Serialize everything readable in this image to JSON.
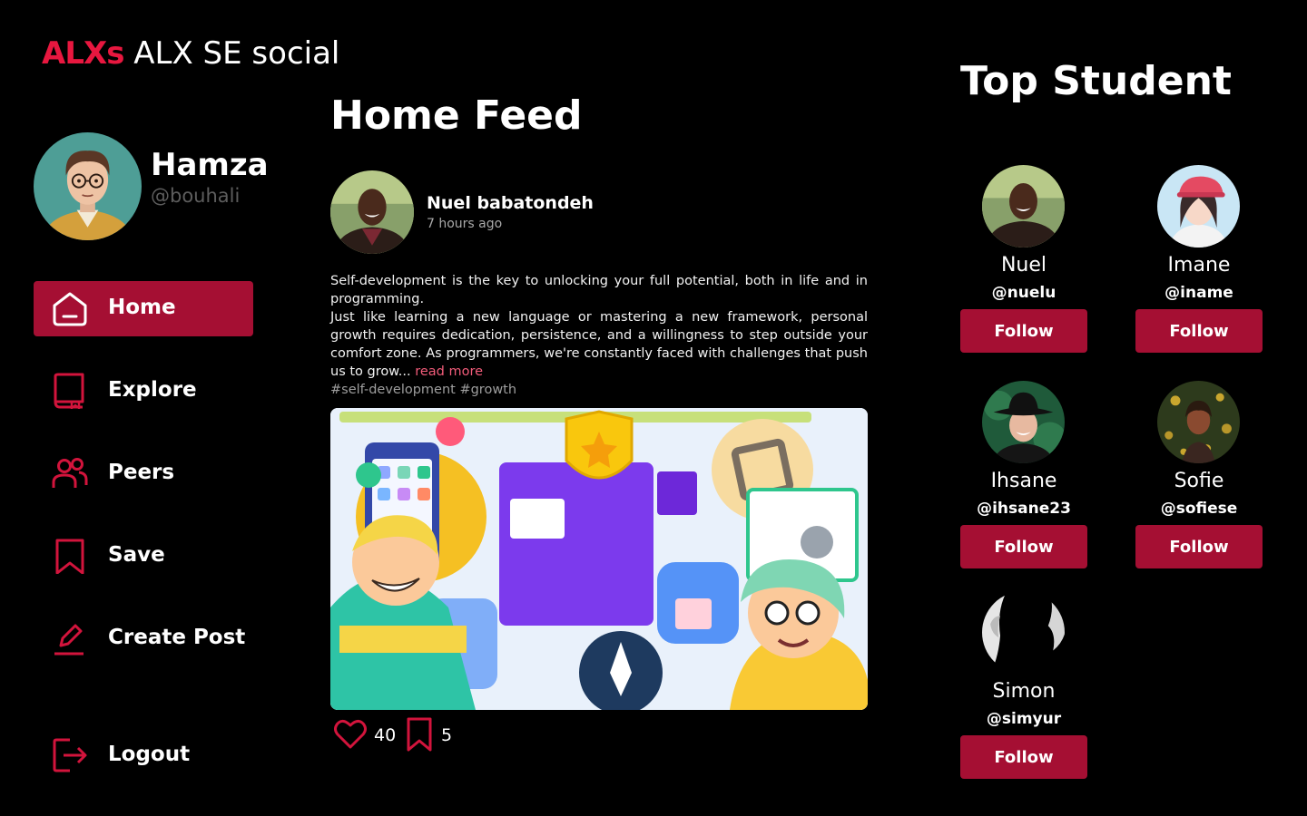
{
  "brand": {
    "accent": "ALXs",
    "name": "ALX SE social"
  },
  "profile": {
    "name": "Hamza",
    "handle": "@bouhali"
  },
  "nav": {
    "home": "Home",
    "explore": "Explore",
    "peers": "Peers",
    "save": "Save",
    "create_post": "Create Post",
    "logout": "Logout"
  },
  "feed": {
    "title": "Home Feed",
    "post": {
      "author": "Nuel babatondeh",
      "time": "7 hours ago",
      "paragraph1": "Self-development is the key to unlocking your full potential, both in life and in programming.",
      "paragraph2": "Just like learning a new language or mastering a new framework, personal growth requires dedication, persistence, and a willingness to step outside your comfort zone. As programmers, we're constantly faced with challenges that push us to grow...",
      "read_more": "read more",
      "tags": "#self-development #growth",
      "likes": "40",
      "saves": "5"
    }
  },
  "top_students": {
    "title": "Top Student",
    "follow_label": "Follow",
    "items": [
      {
        "name": "Nuel",
        "handle": "@nuelu"
      },
      {
        "name": "Imane",
        "handle": "@iname"
      },
      {
        "name": "Ihsane",
        "handle": "@ihsane23"
      },
      {
        "name": "Sofie",
        "handle": "@sofiese"
      },
      {
        "name": "Simon",
        "handle": "@simyur"
      }
    ]
  },
  "colors": {
    "accent": "#a50f33",
    "brand": "#e8173f",
    "background": "#000000",
    "link": "#f25c7a"
  },
  "icons": [
    "home-icon",
    "book-icon",
    "users-icon",
    "bookmark-icon",
    "edit-icon",
    "logout-icon",
    "heart-icon"
  ]
}
